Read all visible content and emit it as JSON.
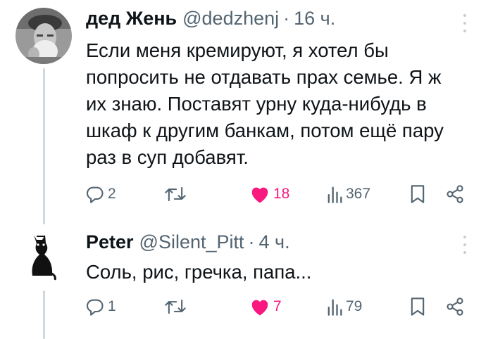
{
  "tweets": [
    {
      "author": {
        "name": "дед Жень",
        "handle": "@dedzhenj",
        "time": "16 ч."
      },
      "separator": "·",
      "avatar_icon": "old-man-photo-icon",
      "text_lines": [
        "Если меня кремируют, я хотел бы",
        "попросить не отдавать прах семье. Я ж",
        "их знаю. Поставят урну куда-нибудь в",
        "шкаф к другим банкам, потом ещё пару",
        "раз в суп добавят."
      ],
      "actions": {
        "replies": "2",
        "retweets": "",
        "likes": "18",
        "views": "367"
      }
    },
    {
      "author": {
        "name": "Peter",
        "handle": "@Silent_Pitt",
        "time": "4 ч."
      },
      "separator": "·",
      "avatar_icon": "black-cat-icon",
      "text_lines": [
        "Соль, рис, гречка, папа..."
      ],
      "actions": {
        "replies": "1",
        "retweets": "",
        "likes": "7",
        "views": "79"
      }
    }
  ],
  "colors": {
    "text": "#0f1419",
    "secondary": "#536471",
    "like": "#f91880",
    "thread_line": "#cfd9de"
  }
}
